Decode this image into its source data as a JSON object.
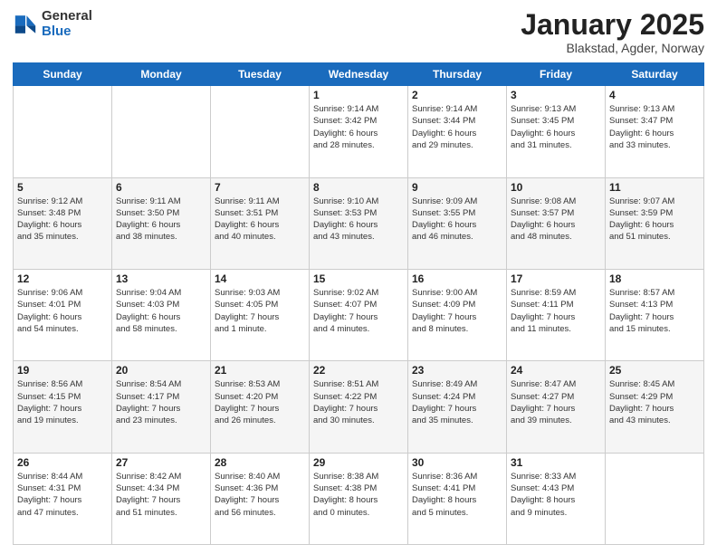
{
  "logo": {
    "general": "General",
    "blue": "Blue"
  },
  "title": "January 2025",
  "subtitle": "Blakstad, Agder, Norway",
  "weekdays": [
    "Sunday",
    "Monday",
    "Tuesday",
    "Wednesday",
    "Thursday",
    "Friday",
    "Saturday"
  ],
  "weeks": [
    [
      {
        "day": "",
        "info": ""
      },
      {
        "day": "",
        "info": ""
      },
      {
        "day": "",
        "info": ""
      },
      {
        "day": "1",
        "info": "Sunrise: 9:14 AM\nSunset: 3:42 PM\nDaylight: 6 hours\nand 28 minutes."
      },
      {
        "day": "2",
        "info": "Sunrise: 9:14 AM\nSunset: 3:44 PM\nDaylight: 6 hours\nand 29 minutes."
      },
      {
        "day": "3",
        "info": "Sunrise: 9:13 AM\nSunset: 3:45 PM\nDaylight: 6 hours\nand 31 minutes."
      },
      {
        "day": "4",
        "info": "Sunrise: 9:13 AM\nSunset: 3:47 PM\nDaylight: 6 hours\nand 33 minutes."
      }
    ],
    [
      {
        "day": "5",
        "info": "Sunrise: 9:12 AM\nSunset: 3:48 PM\nDaylight: 6 hours\nand 35 minutes."
      },
      {
        "day": "6",
        "info": "Sunrise: 9:11 AM\nSunset: 3:50 PM\nDaylight: 6 hours\nand 38 minutes."
      },
      {
        "day": "7",
        "info": "Sunrise: 9:11 AM\nSunset: 3:51 PM\nDaylight: 6 hours\nand 40 minutes."
      },
      {
        "day": "8",
        "info": "Sunrise: 9:10 AM\nSunset: 3:53 PM\nDaylight: 6 hours\nand 43 minutes."
      },
      {
        "day": "9",
        "info": "Sunrise: 9:09 AM\nSunset: 3:55 PM\nDaylight: 6 hours\nand 46 minutes."
      },
      {
        "day": "10",
        "info": "Sunrise: 9:08 AM\nSunset: 3:57 PM\nDaylight: 6 hours\nand 48 minutes."
      },
      {
        "day": "11",
        "info": "Sunrise: 9:07 AM\nSunset: 3:59 PM\nDaylight: 6 hours\nand 51 minutes."
      }
    ],
    [
      {
        "day": "12",
        "info": "Sunrise: 9:06 AM\nSunset: 4:01 PM\nDaylight: 6 hours\nand 54 minutes."
      },
      {
        "day": "13",
        "info": "Sunrise: 9:04 AM\nSunset: 4:03 PM\nDaylight: 6 hours\nand 58 minutes."
      },
      {
        "day": "14",
        "info": "Sunrise: 9:03 AM\nSunset: 4:05 PM\nDaylight: 7 hours\nand 1 minute."
      },
      {
        "day": "15",
        "info": "Sunrise: 9:02 AM\nSunset: 4:07 PM\nDaylight: 7 hours\nand 4 minutes."
      },
      {
        "day": "16",
        "info": "Sunrise: 9:00 AM\nSunset: 4:09 PM\nDaylight: 7 hours\nand 8 minutes."
      },
      {
        "day": "17",
        "info": "Sunrise: 8:59 AM\nSunset: 4:11 PM\nDaylight: 7 hours\nand 11 minutes."
      },
      {
        "day": "18",
        "info": "Sunrise: 8:57 AM\nSunset: 4:13 PM\nDaylight: 7 hours\nand 15 minutes."
      }
    ],
    [
      {
        "day": "19",
        "info": "Sunrise: 8:56 AM\nSunset: 4:15 PM\nDaylight: 7 hours\nand 19 minutes."
      },
      {
        "day": "20",
        "info": "Sunrise: 8:54 AM\nSunset: 4:17 PM\nDaylight: 7 hours\nand 23 minutes."
      },
      {
        "day": "21",
        "info": "Sunrise: 8:53 AM\nSunset: 4:20 PM\nDaylight: 7 hours\nand 26 minutes."
      },
      {
        "day": "22",
        "info": "Sunrise: 8:51 AM\nSunset: 4:22 PM\nDaylight: 7 hours\nand 30 minutes."
      },
      {
        "day": "23",
        "info": "Sunrise: 8:49 AM\nSunset: 4:24 PM\nDaylight: 7 hours\nand 35 minutes."
      },
      {
        "day": "24",
        "info": "Sunrise: 8:47 AM\nSunset: 4:27 PM\nDaylight: 7 hours\nand 39 minutes."
      },
      {
        "day": "25",
        "info": "Sunrise: 8:45 AM\nSunset: 4:29 PM\nDaylight: 7 hours\nand 43 minutes."
      }
    ],
    [
      {
        "day": "26",
        "info": "Sunrise: 8:44 AM\nSunset: 4:31 PM\nDaylight: 7 hours\nand 47 minutes."
      },
      {
        "day": "27",
        "info": "Sunrise: 8:42 AM\nSunset: 4:34 PM\nDaylight: 7 hours\nand 51 minutes."
      },
      {
        "day": "28",
        "info": "Sunrise: 8:40 AM\nSunset: 4:36 PM\nDaylight: 7 hours\nand 56 minutes."
      },
      {
        "day": "29",
        "info": "Sunrise: 8:38 AM\nSunset: 4:38 PM\nDaylight: 8 hours\nand 0 minutes."
      },
      {
        "day": "30",
        "info": "Sunrise: 8:36 AM\nSunset: 4:41 PM\nDaylight: 8 hours\nand 5 minutes."
      },
      {
        "day": "31",
        "info": "Sunrise: 8:33 AM\nSunset: 4:43 PM\nDaylight: 8 hours\nand 9 minutes."
      },
      {
        "day": "",
        "info": ""
      }
    ]
  ]
}
